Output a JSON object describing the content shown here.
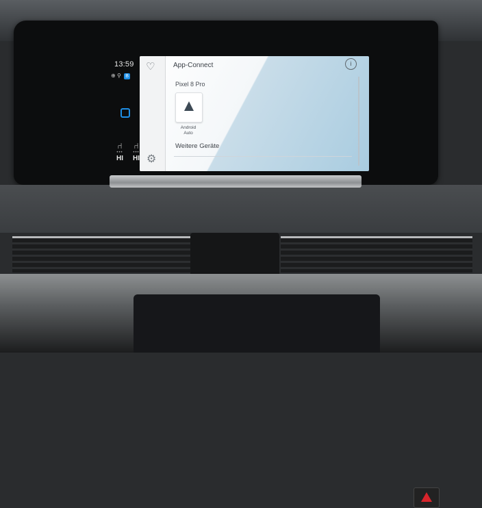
{
  "status": {
    "time": "13:59",
    "seat_left_level": "HI",
    "seat_right_level": "HI"
  },
  "app": {
    "title": "App-Connect",
    "device_name": "Pixel 8 Pro",
    "android_auto_label_line1": "Android",
    "android_auto_label_line2": "Auto",
    "more_devices": "Weitere Geräte"
  },
  "icons": {
    "favorite": "heart-icon",
    "settings": "gear-icon",
    "info": "info-icon",
    "android_auto": "android-auto-icon"
  },
  "colors": {
    "accent": "#1e8fe8"
  }
}
